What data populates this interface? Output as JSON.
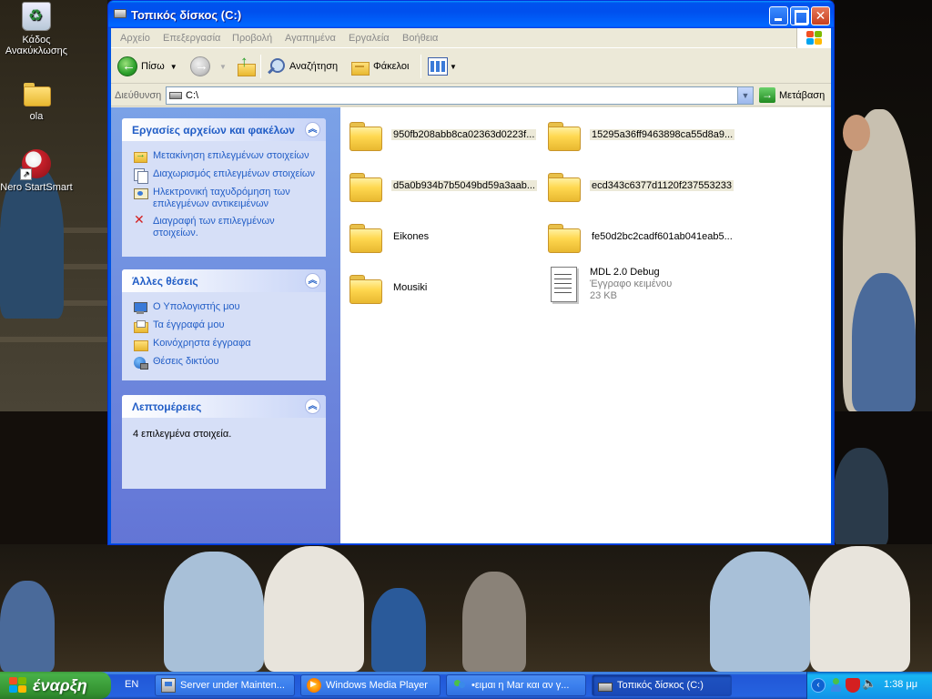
{
  "desktop": {
    "icons": [
      {
        "label": "Κάδος Ανακύκλωσης",
        "icon": "recycle-bin-icon"
      },
      {
        "label": "ola",
        "icon": "folder-icon"
      },
      {
        "label": "Nero StartSmart",
        "icon": "nero-icon"
      }
    ]
  },
  "window": {
    "title": "Τοπικός δίσκος (C:)",
    "menu": [
      "Αρχείο",
      "Επεξεργασία",
      "Προβολή",
      "Αγαπημένα",
      "Εργαλεία",
      "Βοήθεια"
    ],
    "toolbar": {
      "back_label": "Πίσω",
      "search_label": "Αναζήτηση",
      "folders_label": "Φάκελοι"
    },
    "address": {
      "label": "Διεύθυνση",
      "value": "C:\\",
      "go_label": "Μετάβαση"
    }
  },
  "taskpane": {
    "file_tasks": {
      "title": "Εργασίες αρχείων και φακέλων",
      "links": [
        {
          "label": "Μετακίνηση επιλεγμένων στοιχείων",
          "icon": "move-icon"
        },
        {
          "label": "Διαχωρισμός επιλεγμένων στοιχείων",
          "icon": "copy-icon"
        },
        {
          "label": "Ηλεκτρονική ταχυδρόμηση των επιλεγμένων αντικειμένων",
          "icon": "email-icon"
        },
        {
          "label": "Διαγραφή των επιλεγμένων στοιχείων.",
          "icon": "delete-icon"
        }
      ]
    },
    "other_places": {
      "title": "Άλλες θέσεις",
      "links": [
        {
          "label": "Ο Υπολογιστής μου",
          "icon": "my-computer-icon"
        },
        {
          "label": "Τα έγγραφά μου",
          "icon": "my-documents-icon"
        },
        {
          "label": "Κοινόχρηστα έγγραφα",
          "icon": "shared-documents-icon"
        },
        {
          "label": "Θέσεις δικτύου",
          "icon": "network-places-icon"
        }
      ]
    },
    "details": {
      "title": "Λεπτομέρειες",
      "text": "4 επιλεγμένα στοιχεία."
    }
  },
  "files": [
    {
      "name": "950fb208abb8ca02363d0223f...",
      "type": "folder",
      "selected": true
    },
    {
      "name": "15295a36ff9463898ca55d8a9...",
      "type": "folder",
      "selected": true
    },
    {
      "name": "d5a0b934b7b5049bd59a3aab...",
      "type": "folder",
      "selected": true
    },
    {
      "name": "ecd343c6377d1120f237553233",
      "type": "folder",
      "selected": true
    },
    {
      "name": "Eikones",
      "type": "folder",
      "selected": false
    },
    {
      "name": "fe50d2bc2cadf601ab041eab5...",
      "type": "folder",
      "selected": false
    },
    {
      "name": "Mousiki",
      "type": "folder",
      "selected": false
    },
    {
      "name": "MDL 2.0 Debug",
      "type": "text-document",
      "subtype": "Έγγραφο κειμένου",
      "size": "23 KB",
      "selected": false
    }
  ],
  "taskbar": {
    "start_label": "έναρξη",
    "language": "EN",
    "buttons": [
      {
        "label": "Server under Mainten...",
        "icon": "server-icon",
        "active": false
      },
      {
        "label": "Windows Media Player",
        "icon": "media-player-icon",
        "active": false
      },
      {
        "label": "•ειμαι η Mar και αν γ...",
        "icon": "messenger-icon",
        "active": false
      },
      {
        "label": "Τοπικός δίσκος (C:)",
        "icon": "drive-icon",
        "active": true
      }
    ],
    "clock": "1:38 μμ"
  },
  "colors": {
    "title_bar": "#0054e3",
    "task_link": "#215dc6",
    "task_pane_bg": "#7ba2e7",
    "start_button": "#3c9a3c",
    "taskbar": "#2663e0",
    "selection": "#ece9d8"
  }
}
